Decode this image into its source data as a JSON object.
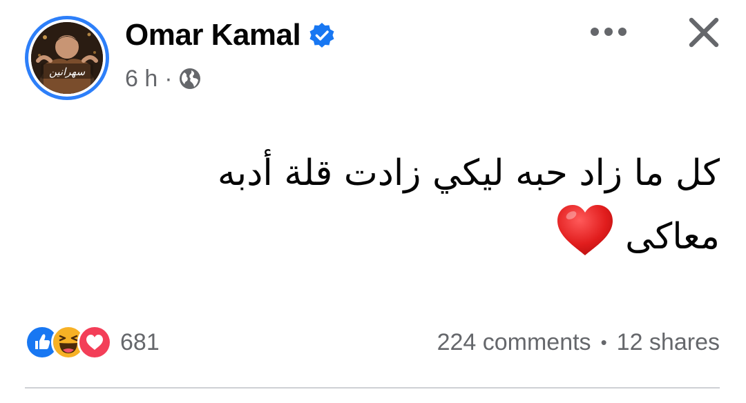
{
  "post": {
    "author": {
      "name": "Omar Kamal",
      "verified": true,
      "avatar_caption": "سهرانين"
    },
    "timestamp": "6 h",
    "separator": "·",
    "audience_icon": "globe-icon",
    "text_line1": "كل ما زاد حبه ليكي زادت قلة أدبه",
    "text_line2": "معاكى",
    "emoji": "red-heart"
  },
  "reactions": {
    "types": [
      "like",
      "haha",
      "love"
    ],
    "count": "681"
  },
  "stats": {
    "comments": "224 comments",
    "dot": "•",
    "shares": "12 shares"
  },
  "colors": {
    "accent": "#2d7ff9",
    "secondary_text": "#65676b",
    "primary_text": "#050505",
    "like": "#1877f2",
    "love": "#f33e58",
    "haha": "#f7b125"
  },
  "icons": {
    "more": "more-horizontal-icon",
    "close": "close-icon",
    "verified": "verified-badge-icon"
  }
}
